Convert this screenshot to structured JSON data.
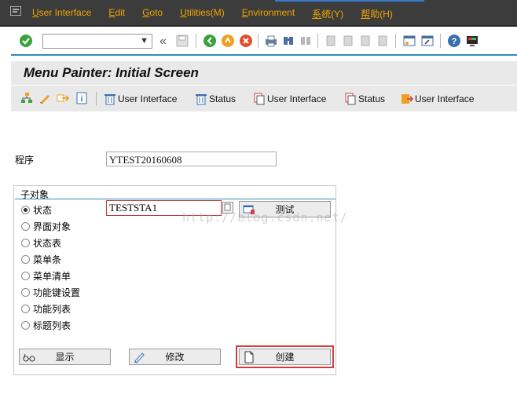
{
  "menubar": {
    "items": [
      {
        "label": "User Interface",
        "underline_index": 0
      },
      {
        "label": "Edit",
        "underline_index": 0
      },
      {
        "label": "Goto",
        "underline_index": 0
      },
      {
        "label": "Utilities(M)",
        "underline_index": 0
      },
      {
        "label": "Environment",
        "underline_index": 0
      },
      {
        "label": "系统(Y)",
        "underline_index": 0
      },
      {
        "label": "帮助(H)",
        "underline_index": 0
      }
    ],
    "text_color": "#f0a500",
    "background": "#3c3c3c"
  },
  "toolbar": {
    "command_field": "",
    "icons": [
      "enter-icon",
      "back-chevron-icon",
      "save-icon",
      "back-icon",
      "exit-icon",
      "cancel-icon",
      "print-icon",
      "find-icon",
      "find-next-icon",
      "first-page-icon",
      "prev-page-icon",
      "next-page-icon",
      "last-page-icon",
      "new-session-icon",
      "shortcut-icon",
      "help-icon",
      "customize-layout-icon"
    ]
  },
  "screen": {
    "title": "Menu Painter: Initial Screen"
  },
  "app_toolbar": {
    "buttons": [
      {
        "label": "User Interface",
        "icon": "trash-icon"
      },
      {
        "label": "Status",
        "icon": "trash-icon"
      },
      {
        "label": "User Interface",
        "icon": "copy-icon"
      },
      {
        "label": "Status",
        "icon": "copy-icon"
      },
      {
        "label": "User Interface",
        "icon": "rename-icon"
      }
    ]
  },
  "program": {
    "label": "程序",
    "value": "YTEST20160608"
  },
  "subobjects": {
    "title": "子对象",
    "options": [
      {
        "label": "状态",
        "selected": true
      },
      {
        "label": "界面对象",
        "selected": false
      },
      {
        "label": "状态表",
        "selected": false
      },
      {
        "label": "菜单条",
        "selected": false
      },
      {
        "label": "菜单清单",
        "selected": false
      },
      {
        "label": "功能键设置",
        "selected": false
      },
      {
        "label": "功能列表",
        "selected": false
      },
      {
        "label": "标题列表",
        "selected": false
      }
    ],
    "status_value": "TESTSTA1",
    "test_button": "测试"
  },
  "actions": {
    "display": "显示",
    "change": "修改",
    "create": "创建"
  },
  "watermark": "http://blog.csdn.net/"
}
